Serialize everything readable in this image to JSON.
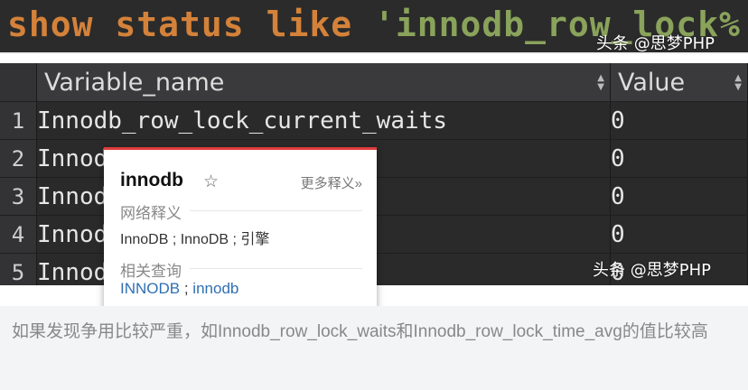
{
  "code": {
    "keyword_show": "show",
    "keyword_status": "status",
    "keyword_like": "like",
    "pattern": "'innodb_row_lock%';"
  },
  "watermarks": {
    "top": "头条 @思梦PHP",
    "table": "头条 @思梦PHP"
  },
  "table": {
    "columns": [
      "Variable_name",
      "Value"
    ],
    "rows": [
      {
        "n": "1",
        "name": "Innodb_row_lock_current_waits",
        "value": "0"
      },
      {
        "n": "2",
        "name": "Innodb_row_lock_time",
        "value": "0"
      },
      {
        "n": "3",
        "name": "Innodb_row_lock_time_avg",
        "value": "0"
      },
      {
        "n": "4",
        "name": "Innodb_row_lock_time_max",
        "value": "0"
      },
      {
        "n": "5",
        "name": "Innodb_row_lock_waits",
        "value": "0"
      }
    ]
  },
  "popup": {
    "word": "innodb",
    "star": "☆",
    "more": "更多释义»",
    "section_web": "网络释义",
    "web_meaning": "InnoDB ; InnoDB ; 引擎",
    "section_related": "相关查询",
    "related_1": "INNODB",
    "related_sep": " ; ",
    "related_2": "innodb"
  },
  "caption": "如果发现争用比较严重，如Innodb_row_lock_waits和Innodb_row_lock_time_avg的值比较高",
  "colors": {
    "keyword": "#d4823a",
    "string": "#8aa35b",
    "table_bg": "#2a2a2b",
    "popup_accent": "#e03b3b",
    "link": "#2f6fb2"
  }
}
